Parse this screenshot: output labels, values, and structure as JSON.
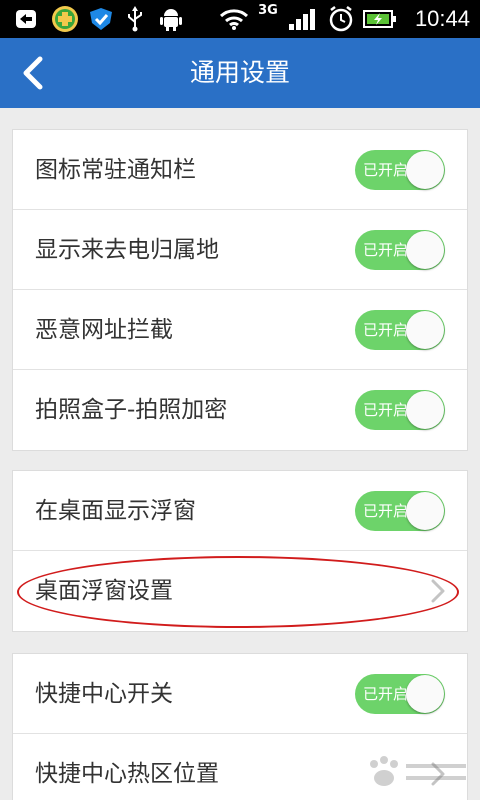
{
  "status_bar": {
    "time": "10:44",
    "network_label": "3G",
    "icons": [
      "notification-back-icon",
      "app-clover-icon",
      "shield-icon",
      "usb-icon",
      "android-debug-icon",
      "wifi-icon",
      "signal-icon",
      "alarm-icon",
      "battery-charging-icon"
    ]
  },
  "header": {
    "title": "通用设置",
    "back_icon": "chevron-left-icon"
  },
  "toggle_on_label": "已开启",
  "groups": [
    {
      "rows": [
        {
          "label": "图标常驻通知栏",
          "type": "toggle",
          "on": true
        },
        {
          "label": "显示来去电归属地",
          "type": "toggle",
          "on": true
        },
        {
          "label": "恶意网址拦截",
          "type": "toggle",
          "on": true
        },
        {
          "label": "拍照盒子-拍照加密",
          "type": "toggle",
          "on": true
        }
      ]
    },
    {
      "rows": [
        {
          "label": "在桌面显示浮窗",
          "type": "toggle",
          "on": true
        },
        {
          "label": "桌面浮窗设置",
          "type": "link"
        }
      ]
    },
    {
      "rows": [
        {
          "label": "快捷中心开关",
          "type": "toggle",
          "on": true
        },
        {
          "label": "快捷中心热区位置",
          "type": "link"
        }
      ]
    }
  ],
  "colors": {
    "header": "#2a70c6",
    "toggle_on": "#6dd36a",
    "annotation": "#d11c1c"
  }
}
